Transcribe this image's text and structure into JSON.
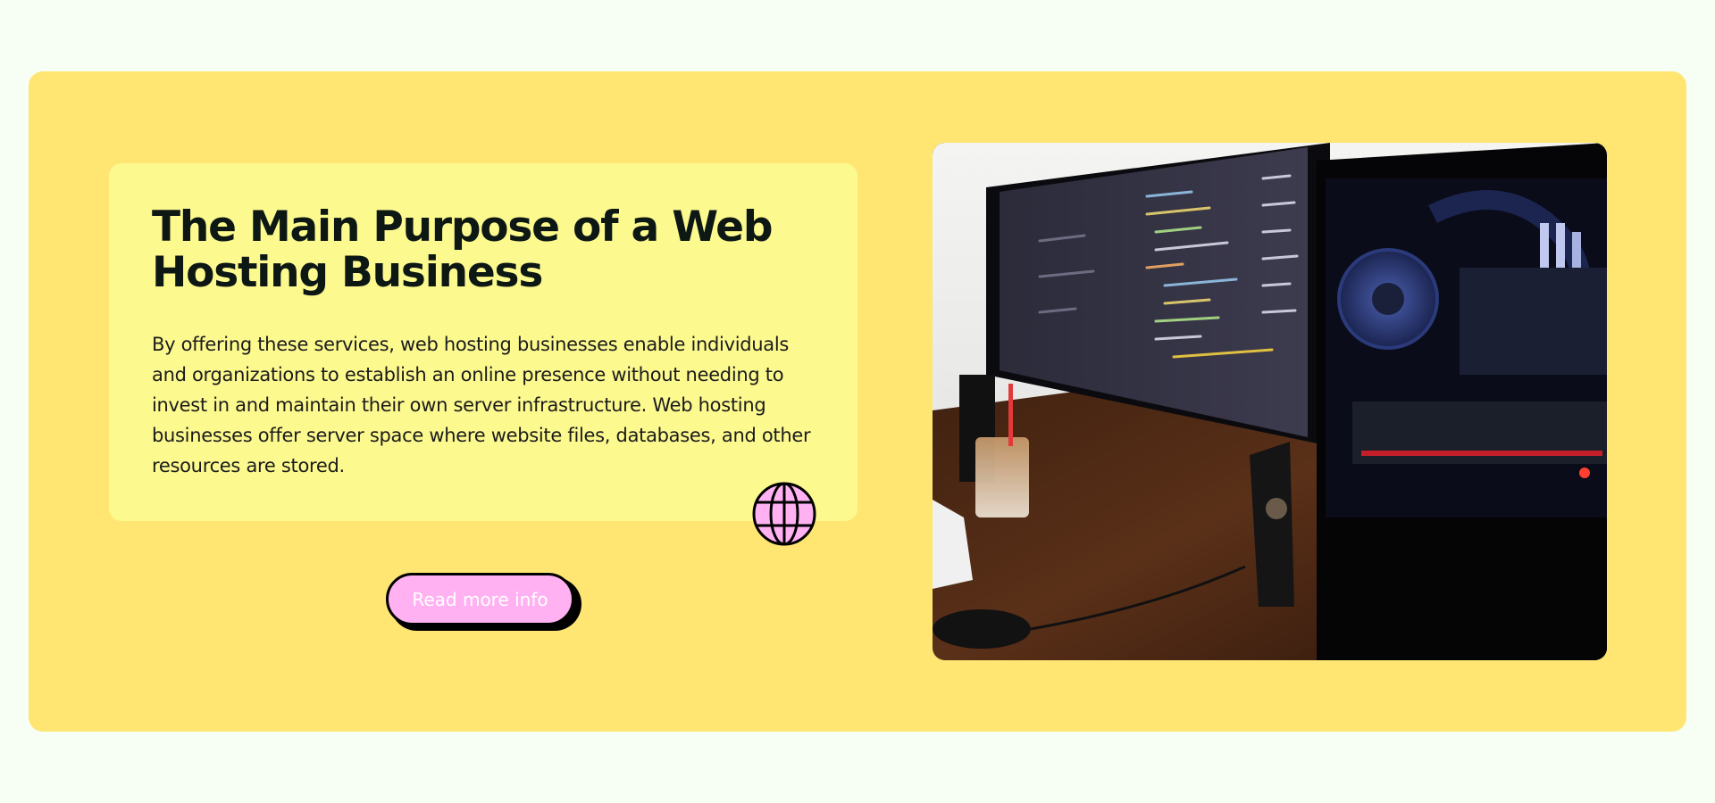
{
  "hero": {
    "title": "The Main Purpose of a Web Hosting Business",
    "description": "By offering these services, web hosting businesses enable individuals and organizations to establish an online presence without needing to invest in and maintain their own server infrastructure. Web hosting businesses offer server space where website files, databases, and other resources are stored.",
    "button_label": "Read more info",
    "badge_icon": "globe-icon",
    "image_alt": "desk-setup-photo"
  },
  "colors": {
    "page_bg": "#f7fff5",
    "section_bg": "#ffe672",
    "card_bg": "#fcf98f",
    "button_bg": "#ffb1f2",
    "title_color": "#0d1714"
  }
}
